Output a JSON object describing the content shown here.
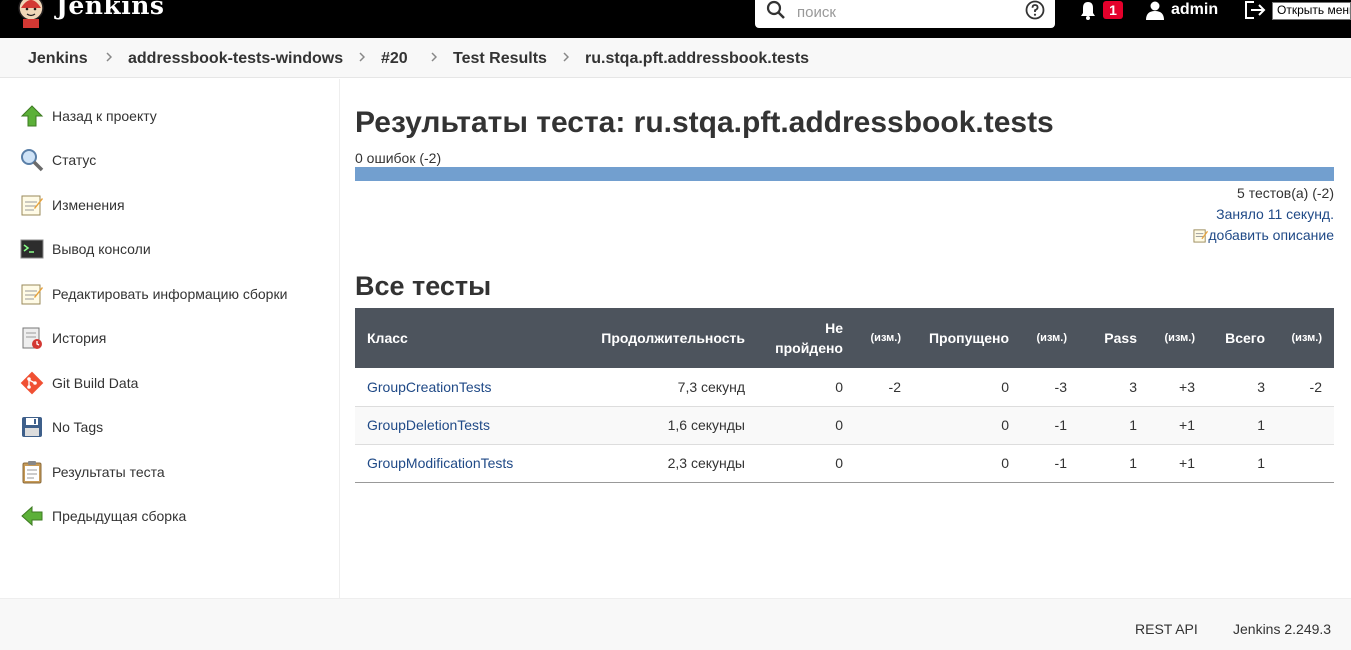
{
  "header": {
    "brand": "Jenkins",
    "search_placeholder": "поиск",
    "notification_count": "1",
    "user": "admin",
    "logout_tooltip": "Открыть меню"
  },
  "breadcrumb": [
    "Jenkins",
    "addressbook-tests-windows",
    "#20",
    "Test Results",
    "ru.stqa.pft.addressbook.tests"
  ],
  "sidebar": {
    "items": [
      {
        "label": "Назад к проекту",
        "icon": "up-arrow-icon"
      },
      {
        "label": "Статус",
        "icon": "magnifier-icon"
      },
      {
        "label": "Изменения",
        "icon": "notepad-icon"
      },
      {
        "label": "Вывод консоли",
        "icon": "terminal-icon"
      },
      {
        "label": "Редактировать информацию сборки",
        "icon": "edit-notepad-icon"
      },
      {
        "label": "История",
        "icon": "history-icon"
      },
      {
        "label": "Git Build Data",
        "icon": "git-icon"
      },
      {
        "label": "No Tags",
        "icon": "floppy-icon"
      },
      {
        "label": "Результаты теста",
        "icon": "clipboard-icon"
      },
      {
        "label": "Предыдущая сборка",
        "icon": "back-arrow-icon"
      }
    ]
  },
  "main": {
    "title": "Результаты теста: ru.stqa.pft.addressbook.tests",
    "fail_count": "0 ошибок (-2)",
    "progress": {
      "passed_fraction": 1.0,
      "color": "#729fcf"
    },
    "tests_count": "5 тестов(а) (-2)",
    "took": "Заняло 11 секунд.",
    "add_description": "добавить описание",
    "section_title": "Все тесты",
    "table": {
      "headers": [
        "Класс",
        "Продолжительность",
        "Не пройдено",
        "(изм.)",
        "Пропущено",
        "(изм.)",
        "Pass",
        "(изм.)",
        "Всего",
        "(изм.)"
      ],
      "rows": [
        {
          "class": "GroupCreationTests",
          "duration": "7,3 секунд",
          "failed": "0",
          "failed_diff": "-2",
          "skipped": "0",
          "skipped_diff": "-3",
          "pass": "3",
          "pass_diff": "+3",
          "total": "3",
          "total_diff": "-2"
        },
        {
          "class": "GroupDeletionTests",
          "duration": "1,6 секунды",
          "failed": "0",
          "failed_diff": "",
          "skipped": "0",
          "skipped_diff": "-1",
          "pass": "1",
          "pass_diff": "+1",
          "total": "1",
          "total_diff": ""
        },
        {
          "class": "GroupModificationTests",
          "duration": "2,3 секунды",
          "failed": "0",
          "failed_diff": "",
          "skipped": "0",
          "skipped_diff": "-1",
          "pass": "1",
          "pass_diff": "+1",
          "total": "1",
          "total_diff": ""
        }
      ]
    }
  },
  "footer": {
    "rest_api": "REST API",
    "version": "Jenkins 2.249.3"
  }
}
